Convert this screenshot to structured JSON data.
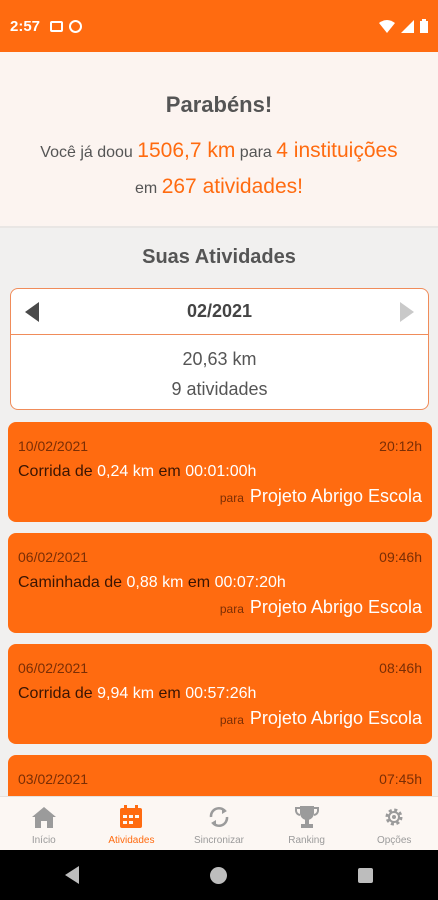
{
  "status": {
    "time": "2:57"
  },
  "congrats": {
    "title": "Parabéns!",
    "prefix": "Você já doou",
    "distance": "1506,7 km",
    "mid1": "para",
    "institutions": "4 instituições",
    "mid2": "em",
    "activities": "267 atividades!"
  },
  "section_title": "Suas Atividades",
  "month": {
    "label": "02/2021",
    "km": "20,63 km",
    "count": "9 atividades"
  },
  "activities": [
    {
      "date": "10/02/2021",
      "time": "20:12h",
      "type": "Corrida de",
      "distance": "0,24 km",
      "em": "em",
      "duration": "00:01:00h",
      "para": "para",
      "dest": "Projeto Abrigo Escola"
    },
    {
      "date": "06/02/2021",
      "time": "09:46h",
      "type": "Caminhada de",
      "distance": "0,88 km",
      "em": "em",
      "duration": "00:07:20h",
      "para": "para",
      "dest": "Projeto Abrigo Escola"
    },
    {
      "date": "06/02/2021",
      "time": "08:46h",
      "type": "Corrida de",
      "distance": "9,94 km",
      "em": "em",
      "duration": "00:57:26h",
      "para": "para",
      "dest": "Projeto Abrigo Escola"
    },
    {
      "date": "03/02/2021",
      "time": "07:45h"
    }
  ],
  "tabs": [
    {
      "label": "Início",
      "icon": "home-icon"
    },
    {
      "label": "Atividades",
      "icon": "calendar-icon"
    },
    {
      "label": "Sincronizar",
      "icon": "sync-icon"
    },
    {
      "label": "Ranking",
      "icon": "trophy-icon"
    },
    {
      "label": "Opções",
      "icon": "gear-icon"
    }
  ],
  "colors": {
    "accent": "#ff6b10",
    "card_dark_text": "#7a2e05"
  }
}
